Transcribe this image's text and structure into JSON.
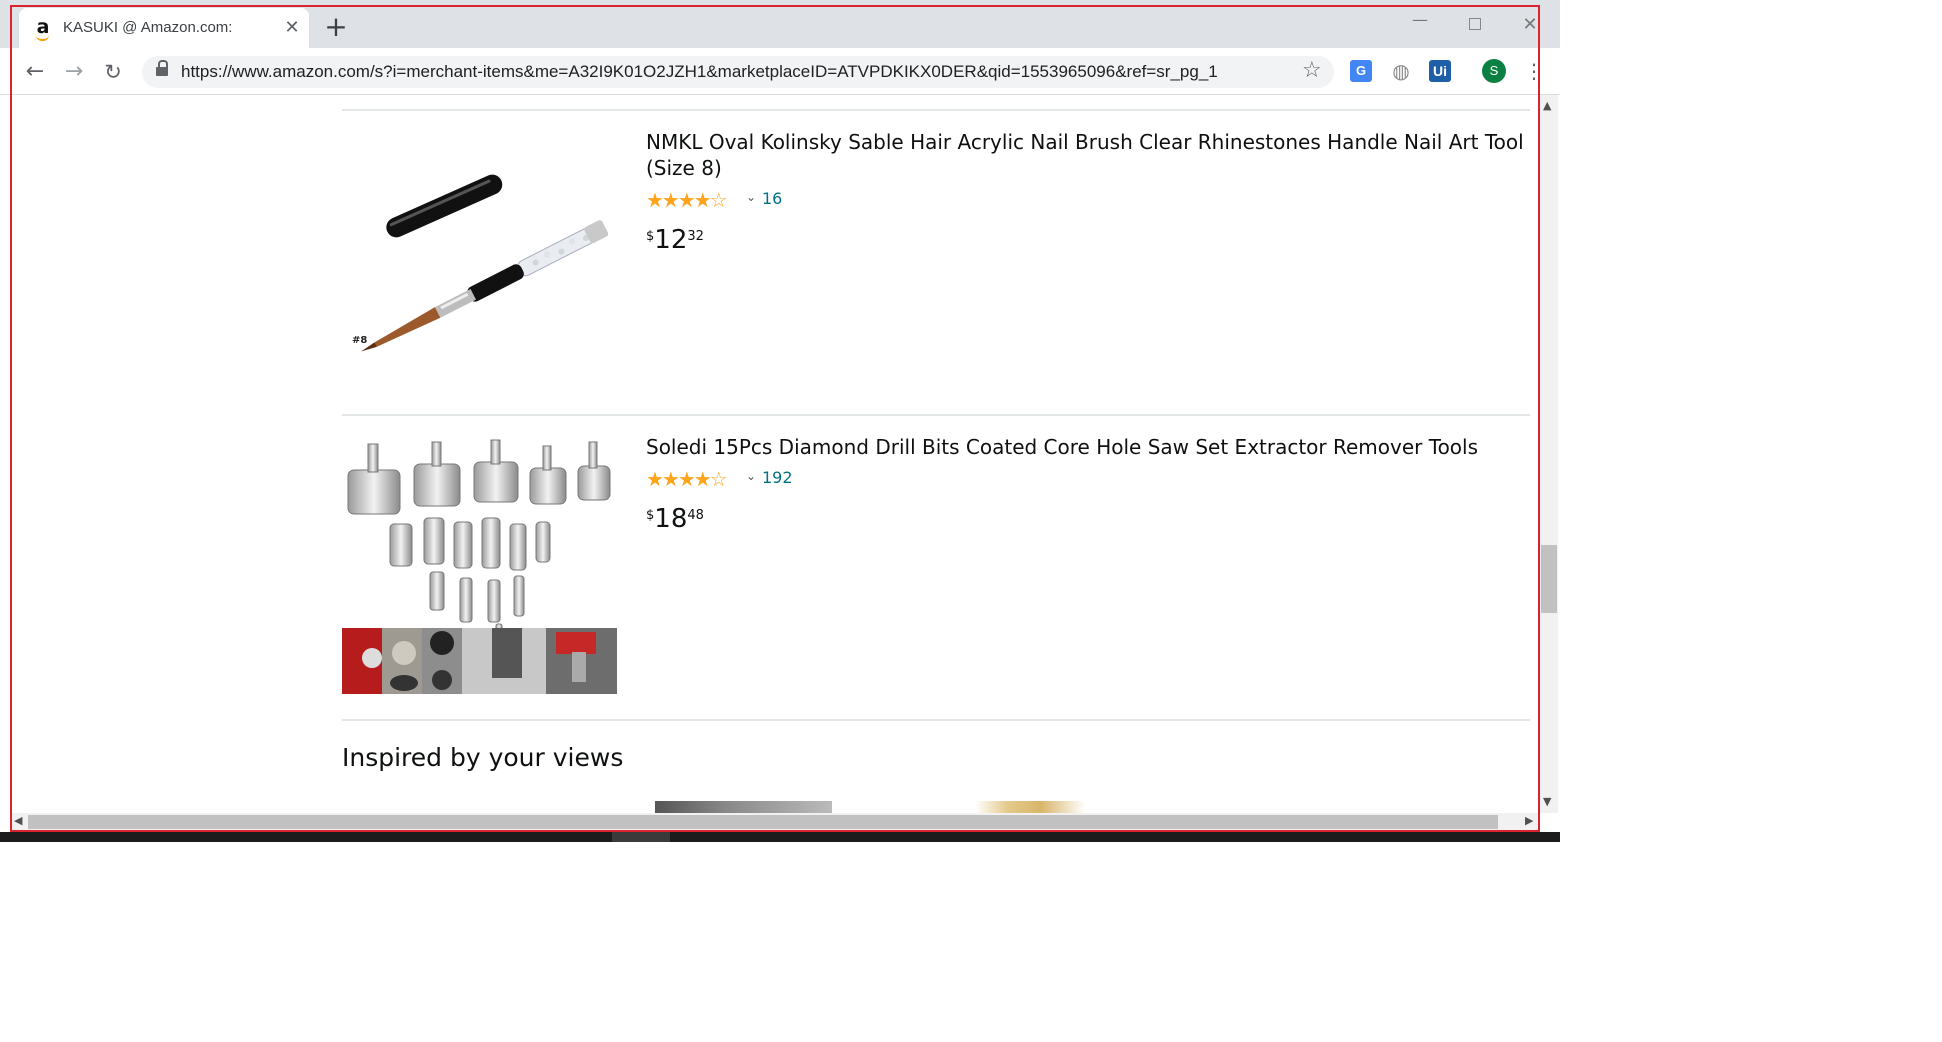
{
  "browser": {
    "tab": {
      "title": "KASUKI @ Amazon.com:",
      "favicon": "amazon-a-icon"
    },
    "url": "https://www.amazon.com/s?i=merchant-items&me=A32I9K01O2JZH1&marketplaceID=ATVPDKIKX0DER&qid=1553965096&ref=sr_pg_1",
    "profile_initial": "S",
    "extensions": [
      "google-translate-icon",
      "globe-icon",
      "uipath-icon"
    ],
    "ext_ui_label": "Ui"
  },
  "products": [
    {
      "title": "NMKL Oval Kolinsky Sable Hair Acrylic Nail Brush Clear Rhinestones Handle Nail Art Tool (Size 8)",
      "rating_stars": 3.5,
      "reviews": "16",
      "price_symbol": "$",
      "price_whole": "12",
      "price_fraction": "32",
      "image_caption": "#8"
    },
    {
      "title": "Soledi 15Pcs Diamond Drill Bits Coated Core Hole Saw Set Extractor Remover Tools",
      "rating_stars": 3.5,
      "reviews": "192",
      "price_symbol": "$",
      "price_whole": "18",
      "price_fraction": "48"
    }
  ],
  "section_heading": "Inspired by your views",
  "colors": {
    "star": "#ffa41c",
    "link": "#007185",
    "annotation_frame": "#d9232f"
  }
}
